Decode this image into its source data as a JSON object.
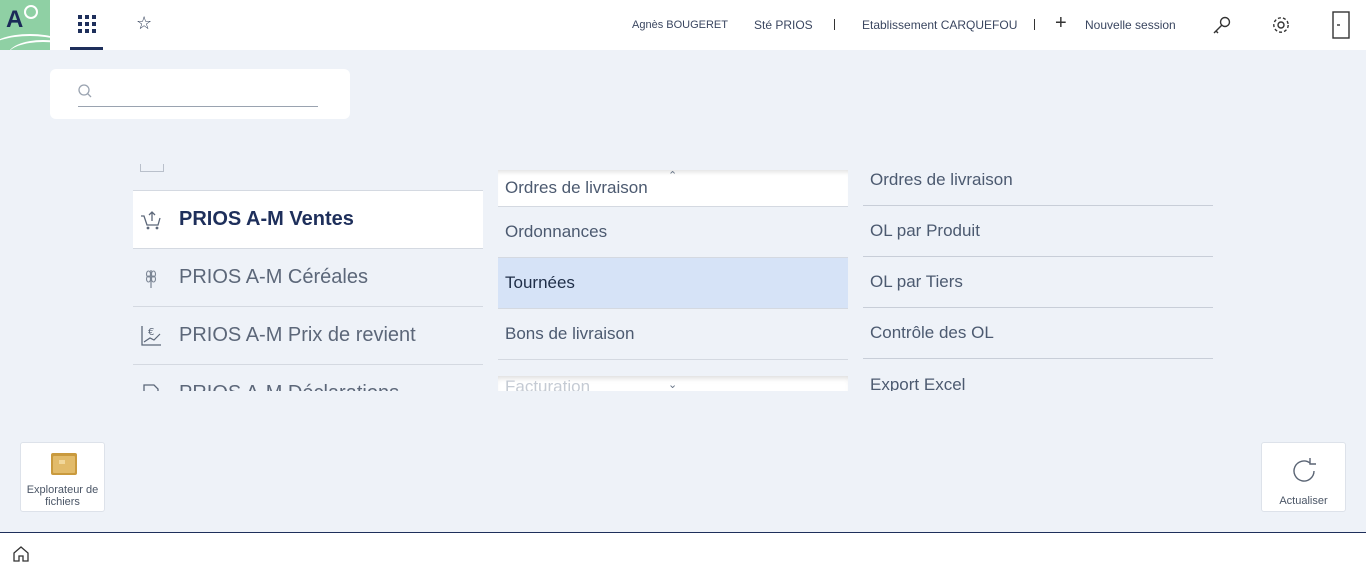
{
  "header": {
    "user": "Agnès BOUGERET",
    "company": "Sté PRIOS",
    "establishment": "Etablissement CARQUEFOU",
    "new_session": "Nouvelle session",
    "logo_letter": "A"
  },
  "search": {
    "placeholder": ""
  },
  "applications": [
    {
      "label": "PRIOS A-M Ventes",
      "icon": "cart-icon",
      "active": true
    },
    {
      "label": "PRIOS A-M Céréales",
      "icon": "wheat-icon",
      "active": false
    },
    {
      "label": "PRIOS A-M Prix de revient",
      "icon": "cost-chart-icon",
      "active": false
    },
    {
      "label": "PRIOS A-M Déclarations",
      "icon": "document-icon",
      "active": false
    }
  ],
  "submenu": [
    {
      "label": "Ordres de livraison",
      "selected": false
    },
    {
      "label": "Ordonnances",
      "selected": false
    },
    {
      "label": "Tournées",
      "selected": true
    },
    {
      "label": "Bons de livraison",
      "selected": false
    },
    {
      "label": "Facturation",
      "selected": false
    }
  ],
  "leaves": [
    "Ordres de livraison",
    "OL par Produit",
    "OL par Tiers",
    "Contrôle des OL",
    "Export Excel"
  ],
  "tiles": {
    "file_explorer": "Explorateur de fichiers",
    "refresh": "Actualiser"
  },
  "colors": {
    "brand_navy": "#1e2f5b",
    "logo_green": "#8fd0a4",
    "selected_bg": "#d6e3f7",
    "page_bg": "#eef2f8"
  }
}
